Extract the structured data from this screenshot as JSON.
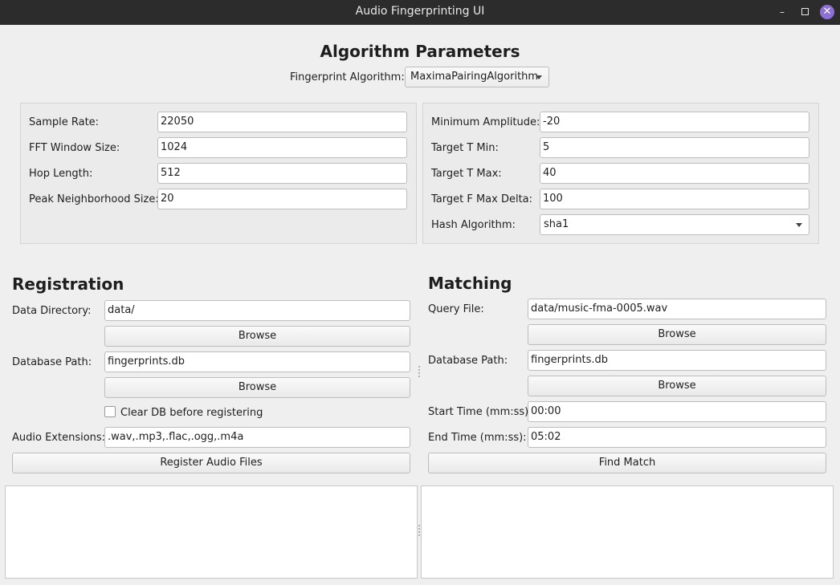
{
  "window": {
    "title": "Audio Fingerprinting UI"
  },
  "params": {
    "heading": "Algorithm Parameters",
    "algorithm_label": "Fingerprint Algorithm:",
    "algorithm_value": "MaximaPairingAlgorithm",
    "sample_rate_label": "Sample Rate:",
    "sample_rate_value": "22050",
    "fft_label": "FFT Window Size:",
    "fft_value": "1024",
    "hop_label": "Hop Length:",
    "hop_value": "512",
    "peak_label": "Peak Neighborhood Size:",
    "peak_value": "20",
    "min_amp_label": "Minimum Amplitude:",
    "min_amp_value": "-20",
    "t_min_label": "Target T Min:",
    "t_min_value": "5",
    "t_max_label": "Target T Max:",
    "t_max_value": "40",
    "f_delta_label": "Target F Max Delta:",
    "f_delta_value": "100",
    "hash_label": "Hash Algorithm:",
    "hash_value": "sha1"
  },
  "registration": {
    "heading": "Registration",
    "data_dir_label": "Data Directory:",
    "data_dir_value": "data/",
    "browse_label": "Browse",
    "db_label": "Database Path:",
    "db_value": "fingerprints.db",
    "browse2_label": "Browse",
    "clear_label": "Clear DB before registering",
    "clear_checked": false,
    "ext_label": "Audio Extensions:",
    "ext_value": ".wav,.mp3,.flac,.ogg,.m4a",
    "register_label": "Register Audio Files"
  },
  "matching": {
    "heading": "Matching",
    "query_label": "Query File:",
    "query_value": "data/music-fma-0005.wav",
    "browse_label": "Browse",
    "db_label": "Database Path:",
    "db_value": "fingerprints.db",
    "browse2_label": "Browse",
    "start_label": "Start Time (mm:ss):",
    "start_value": "00:00",
    "end_label": "End Time (mm:ss):",
    "end_value": "05:02",
    "find_label": "Find Match"
  },
  "colors": {
    "close_button": "#8e6fd6",
    "titlebar": "#2c2c2c"
  }
}
